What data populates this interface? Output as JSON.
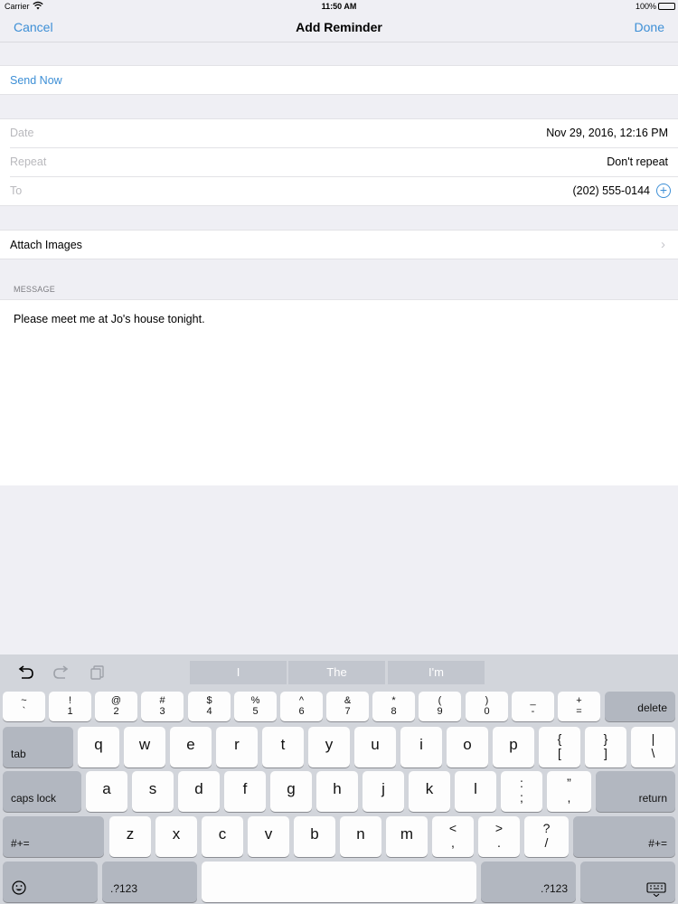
{
  "status": {
    "carrier": "Carrier",
    "time": "11:50 AM",
    "battery": "100%",
    "battery_level": 1.0
  },
  "nav": {
    "cancel": "Cancel",
    "title": "Add Reminder",
    "done": "Done"
  },
  "send_now": "Send Now",
  "fields": {
    "date_label": "Date",
    "date_value": "Nov 29, 2016, 12:16 PM",
    "repeat_label": "Repeat",
    "repeat_value": "Don't repeat",
    "to_label": "To",
    "to_value": "(202) 555-0144"
  },
  "attach": "Attach Images",
  "message_header": "MESSAGE",
  "message_text": "Please meet me at Jo's house tonight.",
  "icons": {
    "plus": "plus-circle-icon",
    "chevron": "chevron-right-icon",
    "undo": "undo-icon",
    "redo": "redo-icon",
    "paste": "paste-icon",
    "emoji": "emoji-icon",
    "dismiss": "keyboard-dismiss-icon"
  },
  "colors": {
    "accent": "#3d8fd6",
    "background": "#efeff4",
    "keyboard": "#d2d5db"
  },
  "keyboard": {
    "suggestions": [
      "I",
      "The",
      "I'm"
    ],
    "number_row": [
      [
        "~",
        "`"
      ],
      [
        "!",
        "1"
      ],
      [
        "@",
        "2"
      ],
      [
        "#",
        "3"
      ],
      [
        "$",
        "4"
      ],
      [
        "%",
        "5"
      ],
      [
        "^",
        "6"
      ],
      [
        "&",
        "7"
      ],
      [
        "*",
        "8"
      ],
      [
        "(",
        "9"
      ],
      [
        ")",
        "0"
      ],
      [
        "_",
        "-"
      ],
      [
        "+",
        "="
      ]
    ],
    "delete": "delete",
    "tab": "tab",
    "row1": [
      "q",
      "w",
      "e",
      "r",
      "t",
      "y",
      "u",
      "i",
      "o",
      "p"
    ],
    "row1_symbols": [
      [
        "{",
        "["
      ],
      [
        "}",
        "]"
      ],
      [
        "|",
        "\\"
      ]
    ],
    "caps": "caps lock",
    "row2": [
      "a",
      "s",
      "d",
      "f",
      "g",
      "h",
      "j",
      "k",
      "l"
    ],
    "row2_symbols": [
      [
        ":",
        ";"
      ],
      [
        "”",
        ","
      ]
    ],
    "return": "return",
    "shift_left": "#+=",
    "row3": [
      "z",
      "x",
      "c",
      "v",
      "b",
      "n",
      "m"
    ],
    "row3_symbols": [
      [
        "<",
        ","
      ],
      [
        ">",
        "."
      ],
      [
        "?",
        "/"
      ]
    ],
    "shift_right": "#+=",
    "num_left": ".?123",
    "num_right": ".?123"
  }
}
